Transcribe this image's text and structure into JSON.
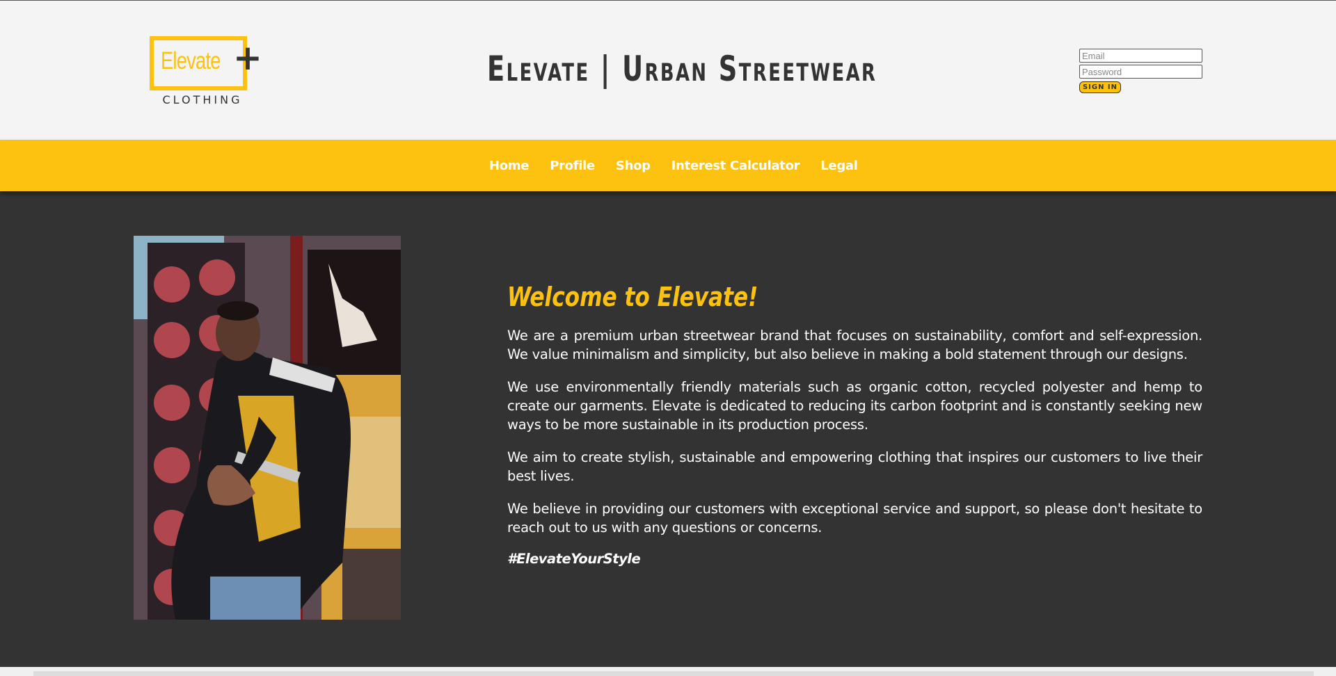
{
  "brand": {
    "logo_word": "Elevate",
    "logo_plus": "+",
    "logo_sub": "CLOTHING",
    "site_title": "Elevate | Urban Streetwear"
  },
  "login": {
    "email_placeholder": "Email",
    "password_placeholder": "Password",
    "signin_label": "SIGN IN"
  },
  "nav": {
    "items": [
      {
        "label": "Home"
      },
      {
        "label": "Profile"
      },
      {
        "label": "Shop"
      },
      {
        "label": "Interest Calculator"
      },
      {
        "label": "Legal"
      }
    ]
  },
  "main": {
    "heading": "Welcome to Elevate!",
    "paragraphs": [
      "We are a premium urban streetwear brand that focuses on sustainability, comfort and self-expression. We value minimalism and simplicity, but also believe in making a bold statement through our designs.",
      "We use environmentally friendly materials such as organic cotton, recycled polyester and hemp to create our garments. Elevate is dedicated to reducing its carbon footprint and is constantly seeking new ways to be more sustainable in its production process.",
      "We aim to create stylish, sustainable and empowering clothing that inspires our customers to live their best lives.",
      "We believe in providing our customers with exceptional service and support, so please don't hesitate to reach out to us with any questions or concerns."
    ],
    "hashtag": "#ElevateYourStyle",
    "photo_icon": "streetwear-model-photo"
  },
  "colors": {
    "accent": "#fcc20f",
    "dark": "#333333",
    "header_bg": "#f4f4f4",
    "text_light": "#ffffff"
  }
}
